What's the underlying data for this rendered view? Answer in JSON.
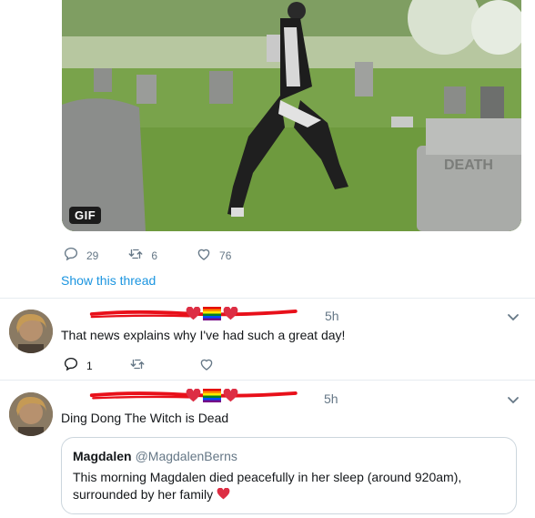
{
  "top_tweet": {
    "media_badge": "GIF",
    "actions": {
      "replies": "29",
      "retweets": "6",
      "likes": "76"
    },
    "show_thread": "Show this thread"
  },
  "reply1": {
    "time": "5h",
    "text": "That news explains why I've had such a great day!",
    "actions": {
      "replies": "1"
    }
  },
  "reply2": {
    "time": "5h",
    "text": "Ding Dong The Witch is Dead"
  },
  "quote": {
    "name": "Magdalen",
    "handle": "@MagdalenBerns",
    "text_line1": "This morning Magdalen died peacefully in her sleep  (around 920am),",
    "text_line2": "surrounded by her family"
  },
  "colors": {
    "link": "#1b95e0",
    "muted": "#657786",
    "redaction": "#e8101a",
    "heart": "#e0245e"
  }
}
